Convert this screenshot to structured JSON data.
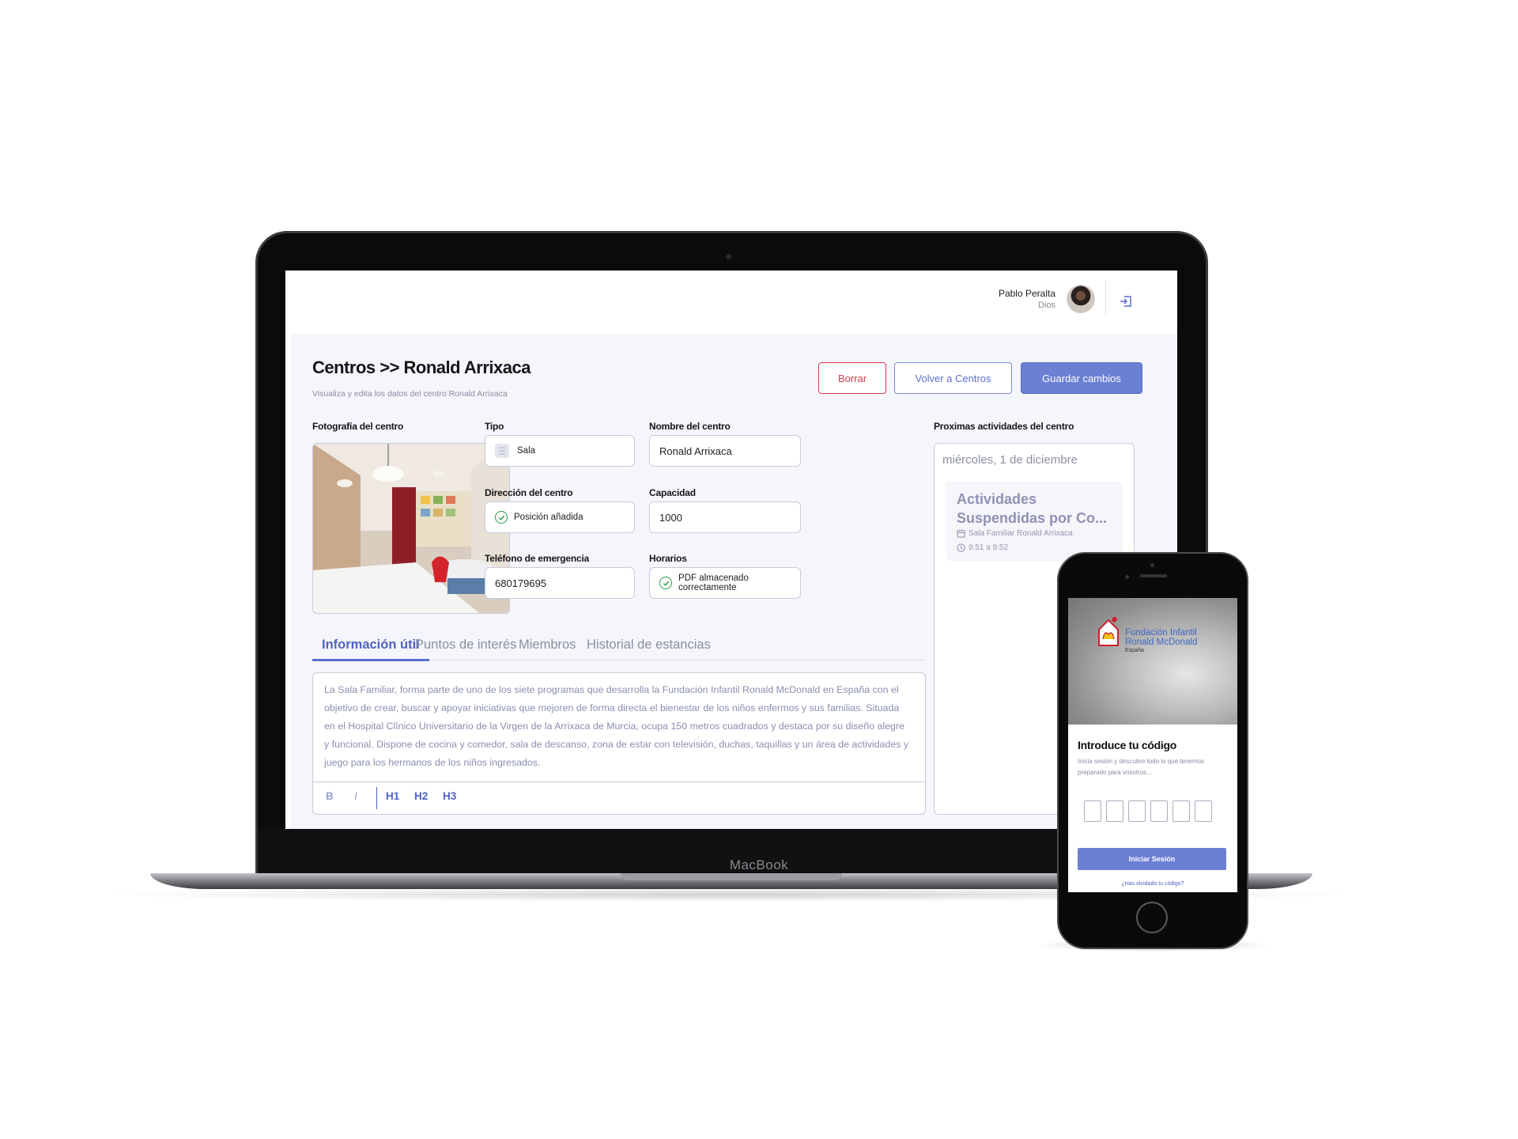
{
  "laptop": {
    "brand": "MacBook",
    "header": {
      "user_name": "Pablo Peralta",
      "user_role": "Dios",
      "avatar_icon": "user-avatar",
      "logout_icon": "logout-icon"
    },
    "page": {
      "title": "Centros >> Ronald Arrixaca",
      "subtitle": "Visualiza y edita los datos del centro Ronald Arrixaca"
    },
    "buttons": {
      "delete": "Borrar",
      "back": "Volver a Centros",
      "save": "Guardar cambios"
    },
    "form": {
      "photo_label": "Fotografía del centro",
      "type_label": "Tipo",
      "type_value": "Sala",
      "name_label": "Nombre del centro",
      "name_value": "Ronald Arrixaca",
      "address_label": "Dirección del centro",
      "address_value": "Posición añadida",
      "capacity_label": "Capacidad",
      "capacity_value": "1000",
      "phone_label": "Teléfono de emergencia",
      "phone_value": "680179695",
      "schedule_label": "Horarios",
      "schedule_value": "PDF almacenado correctamente"
    },
    "activities": {
      "label": "Proximas actividades del centro",
      "date": "miércoles, 1 de diciembre",
      "card_title": "Actividades Suspendidas por Co...",
      "card_location": "Sala Familiar Ronald Arrixaca",
      "card_time": "9:51 a 9:52"
    },
    "tabs": [
      {
        "label": "Información útil",
        "active": true
      },
      {
        "label": "Puntos de interés",
        "active": false
      },
      {
        "label": "Miembros",
        "active": false
      },
      {
        "label": "Historial de estancias",
        "active": false
      }
    ],
    "editor": {
      "text": "La Sala Familiar, forma parte de uno de los siete programas que desarrolla la Fundación Infantil Ronald McDonald en España con el objetivo de crear, buscar y apoyar iniciativas que mejoren de forma directa el bienestar de los niños enfermos y sus familias. Situada en el Hospital Clínico Universitario de la Virgen de la Arrixaca de Murcia, ocupa 150 metros cuadrados y destaca por su diseño alegre y funcional. Dispone de cocina y comedor, sala de descanso, zona de estar con televisión, duchas, taquillas y un área de actividades y juego para los hermanos de los niños ingresados.",
      "toolbar": {
        "bold": "B",
        "italic": "I",
        "h1": "H1",
        "h2": "H2",
        "h3": "H3"
      }
    },
    "colors": {
      "accent": "#6b7fd3",
      "danger": "#d23a4a",
      "success": "#2b9a4b"
    }
  },
  "phone": {
    "brand_line1": "Fundación Infantil",
    "brand_line2": "Ronald McDonald",
    "brand_line3": "España",
    "title": "Introduce tu código",
    "subtitle": "Inicia sesión y descubre todo lo que tenemos preparado para vosotros...",
    "code_length": 6,
    "login_button": "Iniciar Sesión",
    "forgot_link": "¿Has olvidado tu código?"
  }
}
